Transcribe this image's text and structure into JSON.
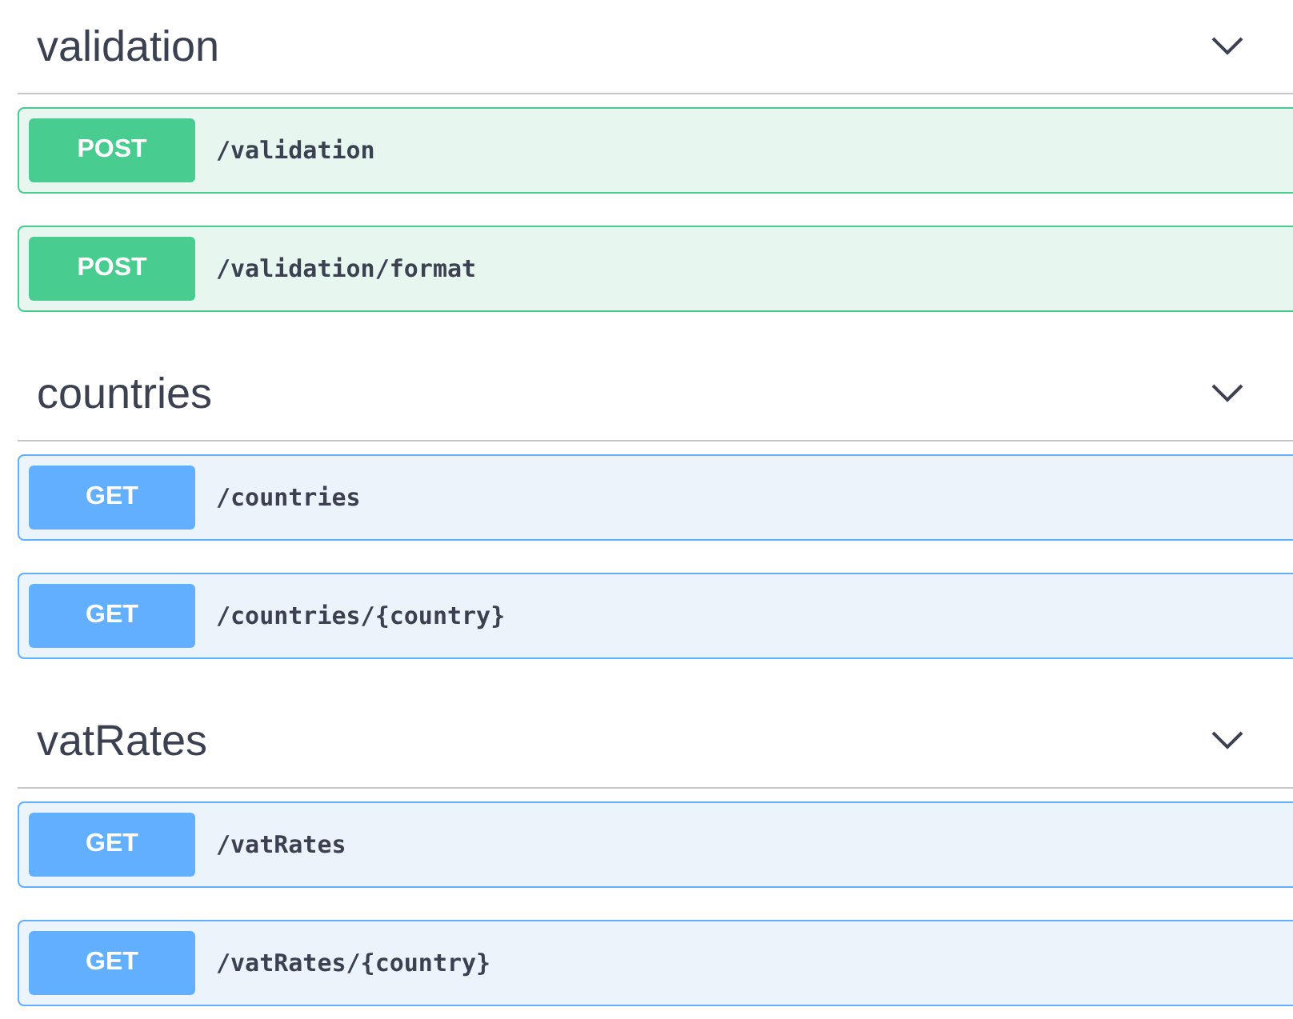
{
  "sections": [
    {
      "title": "validation",
      "expanded": true,
      "operations": [
        {
          "method": "POST",
          "path": "/validation"
        },
        {
          "method": "POST",
          "path": "/validation/format"
        }
      ]
    },
    {
      "title": "countries",
      "expanded": true,
      "operations": [
        {
          "method": "GET",
          "path": "/countries"
        },
        {
          "method": "GET",
          "path": "/countries/{country}"
        }
      ]
    },
    {
      "title": "vatRates",
      "expanded": true,
      "operations": [
        {
          "method": "GET",
          "path": "/vatRates"
        },
        {
          "method": "GET",
          "path": "/vatRates/{country}"
        }
      ]
    }
  ]
}
